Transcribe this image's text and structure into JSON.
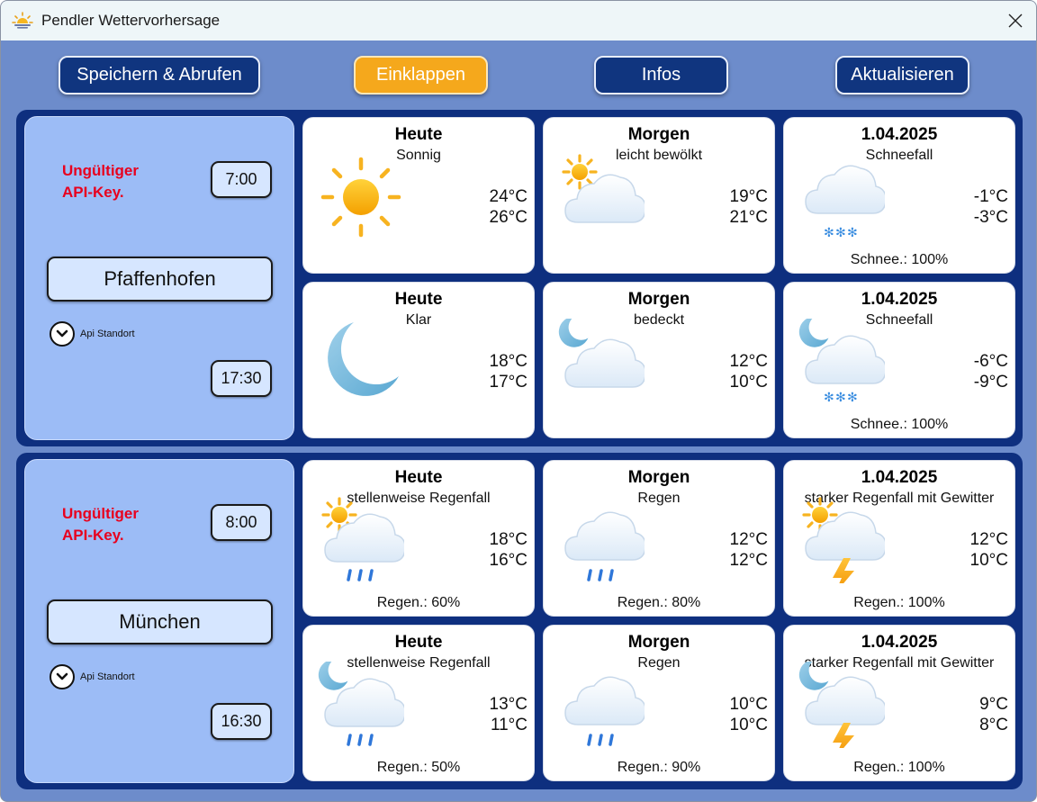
{
  "window": {
    "title": "Pendler Wettervorhersage"
  },
  "toolbar": {
    "save_label": "Speichern & Abrufen",
    "collapse_label": "Einklappen",
    "info_label": "Infos",
    "refresh_label": "Aktualisieren"
  },
  "colors": {
    "accent": "#f5a81c",
    "button": "#10357f",
    "panel": "#0e2f7f",
    "location_card": "#9cbcf6",
    "error": "#e8001e"
  },
  "locations": [
    {
      "error": "Ungültiger API-Key.",
      "time_top": "7:00",
      "name": "Pfaffenhofen",
      "api_label": "Api Standort",
      "time_bottom": "17:30",
      "rows": [
        [
          {
            "day": "Heute",
            "desc": "Sonnig",
            "t1": "24°C",
            "t2": "26°C",
            "extra": "",
            "icon": "sun-icon"
          },
          {
            "day": "Morgen",
            "desc": "leicht bewölkt",
            "t1": "19°C",
            "t2": "21°C",
            "extra": "",
            "icon": "partly-cloudy-icon"
          },
          {
            "day": "1.04.2025",
            "desc": "Schneefall",
            "t1": "-1°C",
            "t2": "-3°C",
            "extra": "Schnee.: 100%",
            "icon": "snow-icon"
          }
        ],
        [
          {
            "day": "Heute",
            "desc": "Klar",
            "t1": "18°C",
            "t2": "17°C",
            "extra": "",
            "icon": "moon-icon"
          },
          {
            "day": "Morgen",
            "desc": "bedeckt",
            "t1": "12°C",
            "t2": "10°C",
            "extra": "",
            "icon": "cloudy-night-icon"
          },
          {
            "day": "1.04.2025",
            "desc": "Schneefall",
            "t1": "-6°C",
            "t2": "-9°C",
            "extra": "Schnee.: 100%",
            "icon": "snow-night-icon"
          }
        ]
      ]
    },
    {
      "error": "Ungültiger API-Key.",
      "time_top": "8:00",
      "name": "München",
      "api_label": "Api Standort",
      "time_bottom": "16:30",
      "rows": [
        [
          {
            "day": "Heute",
            "desc": "stellenweise Regenfall",
            "t1": "18°C",
            "t2": "16°C",
            "extra": "Regen.: 60%",
            "icon": "sun-rain-icon"
          },
          {
            "day": "Morgen",
            "desc": "Regen",
            "t1": "12°C",
            "t2": "12°C",
            "extra": "Regen.: 80%",
            "icon": "rain-icon"
          },
          {
            "day": "1.04.2025",
            "desc": "starker Regenfall mit Gewitter",
            "t1": "12°C",
            "t2": "10°C",
            "extra": "Regen.: 100%",
            "icon": "sun-thunder-icon"
          }
        ],
        [
          {
            "day": "Heute",
            "desc": "stellenweise Regenfall",
            "t1": "13°C",
            "t2": "11°C",
            "extra": "Regen.: 50%",
            "icon": "moon-rain-icon"
          },
          {
            "day": "Morgen",
            "desc": "Regen",
            "t1": "10°C",
            "t2": "10°C",
            "extra": "Regen.: 90%",
            "icon": "rain-icon"
          },
          {
            "day": "1.04.2025",
            "desc": "starker Regenfall mit Gewitter",
            "t1": "9°C",
            "t2": "8°C",
            "extra": "Regen.: 100%",
            "icon": "moon-thunder-icon"
          }
        ]
      ]
    }
  ]
}
